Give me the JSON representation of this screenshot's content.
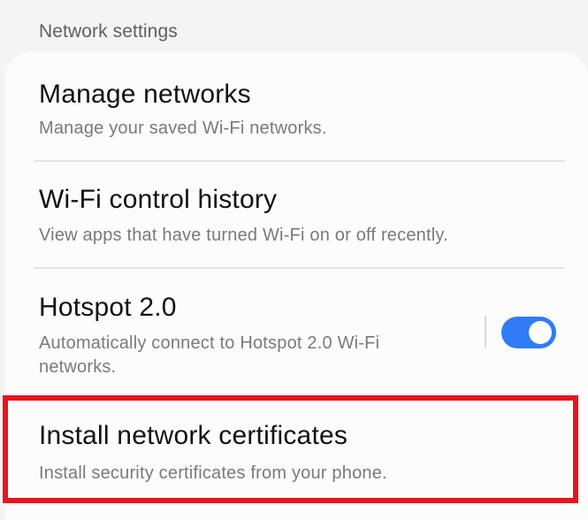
{
  "section_header": "Network settings",
  "items": [
    {
      "title": "Manage networks",
      "subtitle": "Manage your saved Wi-Fi networks."
    },
    {
      "title": "Wi-Fi control history",
      "subtitle": "View apps that have turned Wi-Fi on or off recently."
    },
    {
      "title": "Hotspot 2.0",
      "subtitle_line1": "Automatically connect to Hotspot 2.0 Wi-Fi",
      "subtitle_line2": "networks.",
      "toggle_state": "on"
    },
    {
      "title": "Install network certificates",
      "subtitle": "Install security certificates from your phone."
    }
  ],
  "colors": {
    "toggle_on": "#2f7cf6",
    "highlight": "#e8141c"
  },
  "icons": {
    "toggle": "toggle-switch-icon"
  }
}
